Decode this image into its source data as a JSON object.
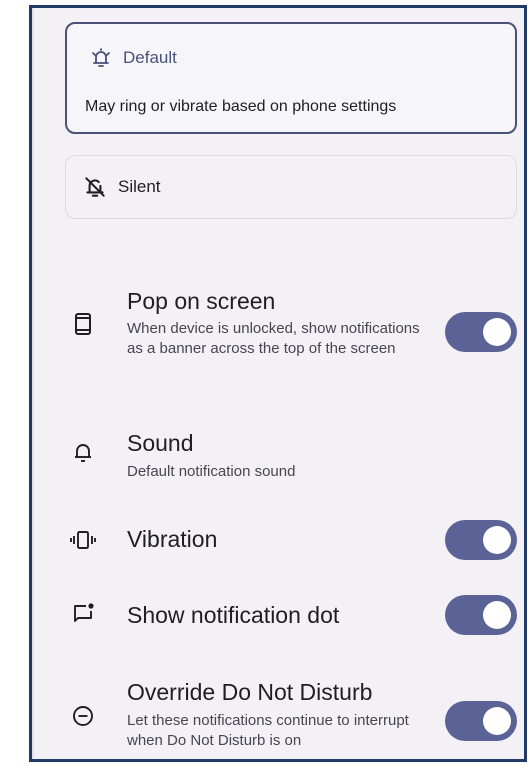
{
  "modes": {
    "default": {
      "label": "Default",
      "description": "May ring or vibrate based on phone settings",
      "selected": true,
      "icon": "bell-ringing-icon"
    },
    "silent": {
      "label": "Silent",
      "selected": false,
      "icon": "bell-off-icon"
    }
  },
  "settings": [
    {
      "title": "Pop on screen",
      "subtitle": "When device is unlocked, show notifications as a banner across the top of the screen",
      "icon": "phone-icon",
      "toggle": true,
      "on": true
    },
    {
      "title": "Sound",
      "subtitle": "Default notification sound",
      "icon": "bell-icon",
      "toggle": false
    },
    {
      "title": "Vibration",
      "subtitle": "",
      "icon": "vibration-icon",
      "toggle": true,
      "on": true
    },
    {
      "title": "Show notification dot",
      "subtitle": "",
      "icon": "notification-dot-icon",
      "toggle": true,
      "on": true
    },
    {
      "title": "Override Do Not Disturb",
      "subtitle": "Let these notifications continue to interrupt when Do Not Disturb is on",
      "icon": "do-not-disturb-icon",
      "toggle": true,
      "on": true
    }
  ],
  "colors": {
    "accent": "#5a6296",
    "selected_border": "#4a5178",
    "background": "#f3f1f6",
    "frame_border": "#1f3a64"
  }
}
